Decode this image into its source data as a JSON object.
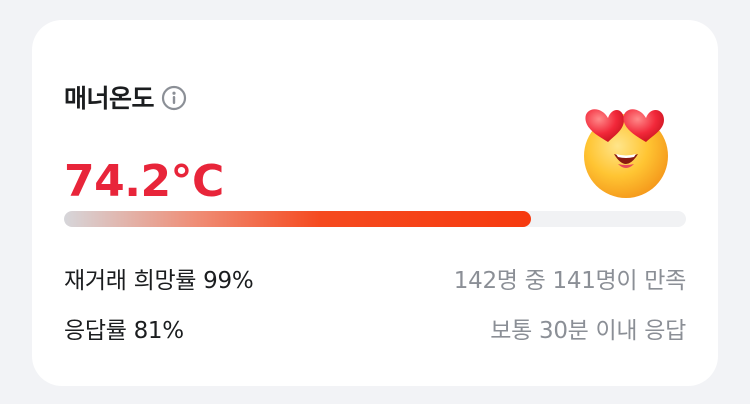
{
  "manner": {
    "title": "매너온도",
    "info_icon": "info-circle-icon",
    "temperature": "74.2°C",
    "temperature_color": "#e8253a",
    "gauge_fill_fraction": 0.75,
    "face_icon": "heart-eyes-face-icon"
  },
  "stats": [
    {
      "label": "재거래 희망률 99%",
      "description": "142명 중 141명이 만족"
    },
    {
      "label": "응답률 81%",
      "description": "보통 30분 이내 응답"
    }
  ]
}
